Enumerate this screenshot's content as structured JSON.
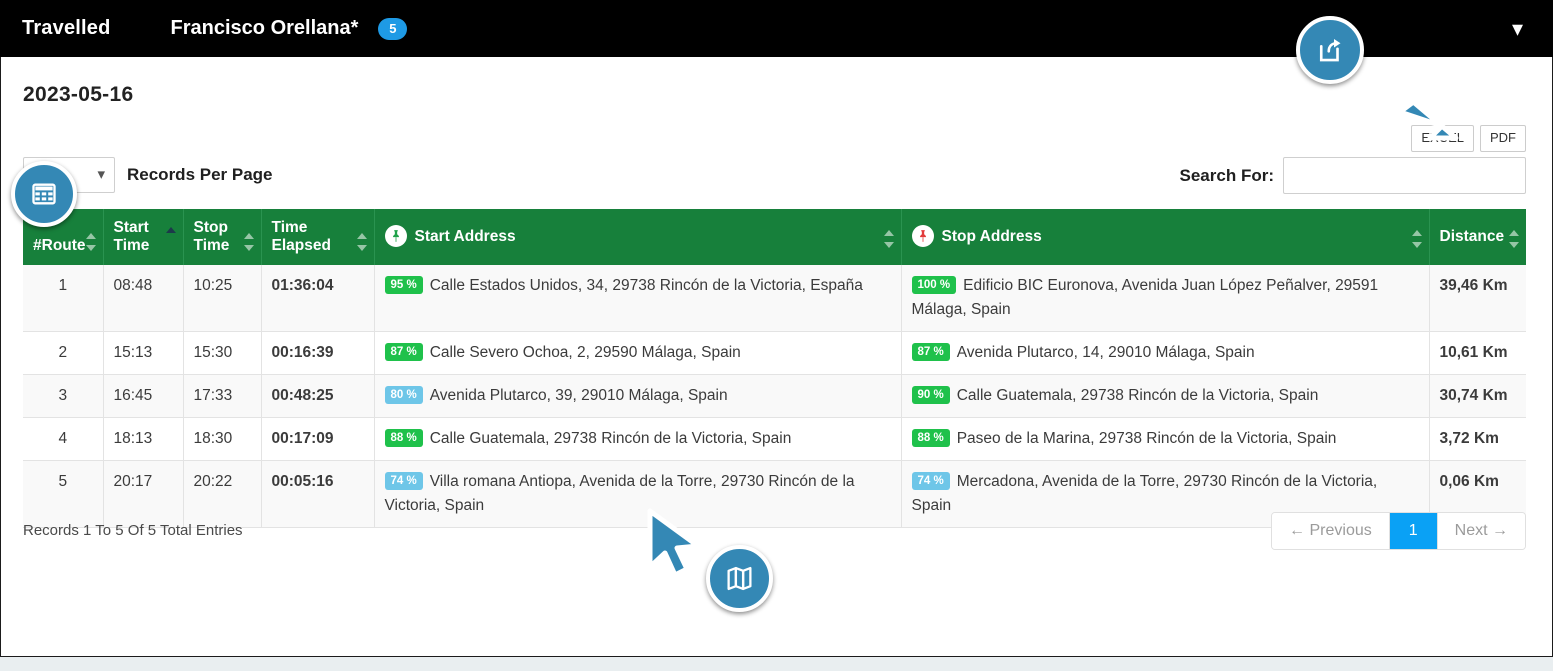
{
  "topbar": {
    "title": "Travelled",
    "user": "Francisco Orellana*",
    "badge_count": "5",
    "chevron_icon": "chevron-down-icon"
  },
  "header": {
    "date": "2023-05-16"
  },
  "export": {
    "excel_label": "EXCEL",
    "pdf_label": "PDF"
  },
  "controls": {
    "records_per_page_label": "Records Per Page",
    "records_per_page_value": "",
    "search_label": "Search For:",
    "search_value": "",
    "search_placeholder": ""
  },
  "table": {
    "columns": [
      {
        "label": "#Route",
        "sort": "none"
      },
      {
        "label": "Start Time",
        "sort": "asc"
      },
      {
        "label": "Stop Time",
        "sort": "none"
      },
      {
        "label": "Time Elapsed",
        "sort": "none"
      },
      {
        "label": "Start Address",
        "sort": "none",
        "icon": "green-pin-icon"
      },
      {
        "label": "Stop Address",
        "sort": "none",
        "icon": "red-pin-icon"
      },
      {
        "label": "Distance",
        "sort": "none"
      }
    ],
    "rows": [
      {
        "route": "1",
        "start_time": "08:48",
        "stop_time": "10:25",
        "elapsed": "01:36:04",
        "start_pct": "95 %",
        "start_pct_color": "green",
        "start_address": "Calle Estados Unidos, 34, 29738 Rincón de la Victoria, España",
        "stop_pct": "100 %",
        "stop_pct_color": "green",
        "stop_address": "Edificio BIC Euronova, Avenida Juan López Peñalver, 29591 Málaga, Spain",
        "distance": "39,46 Km"
      },
      {
        "route": "2",
        "start_time": "15:13",
        "stop_time": "15:30",
        "elapsed": "00:16:39",
        "start_pct": "87 %",
        "start_pct_color": "green",
        "start_address": "Calle Severo Ochoa, 2, 29590 Málaga, Spain",
        "stop_pct": "87 %",
        "stop_pct_color": "green",
        "stop_address": "Avenida Plutarco, 14, 29010 Málaga, Spain",
        "distance": "10,61 Km"
      },
      {
        "route": "3",
        "start_time": "16:45",
        "stop_time": "17:33",
        "elapsed": "00:48:25",
        "start_pct": "80 %",
        "start_pct_color": "blue",
        "start_address": "Avenida Plutarco, 39, 29010 Málaga, Spain",
        "stop_pct": "90 %",
        "stop_pct_color": "green",
        "stop_address": "Calle Guatemala, 29738 Rincón de la Victoria, Spain",
        "distance": "30,74 Km"
      },
      {
        "route": "4",
        "start_time": "18:13",
        "stop_time": "18:30",
        "elapsed": "00:17:09",
        "start_pct": "88 %",
        "start_pct_color": "green",
        "start_address": "Calle Guatemala, 29738 Rincón de la Victoria, Spain",
        "stop_pct": "88 %",
        "stop_pct_color": "green",
        "stop_address": "Paseo de la Marina, 29738 Rincón de la Victoria, Spain",
        "distance": "3,72 Km"
      },
      {
        "route": "5",
        "start_time": "20:17",
        "stop_time": "20:22",
        "elapsed": "00:05:16",
        "start_pct": "74 %",
        "start_pct_color": "blue",
        "start_address": "Villa romana Antiopa, Avenida de la Torre, 29730 Rincón de la Victoria, Spain",
        "stop_pct": "74 %",
        "stop_pct_color": "blue",
        "stop_address": "Mercadona, Avenida de la Torre, 29730 Rincón de la Victoria, Spain",
        "distance": "0,06 Km"
      }
    ]
  },
  "footer": {
    "info": "Records 1 To 5 Of 5 Total Entries",
    "previous_label": "← Previous",
    "page_1_label": "1",
    "next_label": "Next →"
  },
  "annotations": {
    "share_icon": "share-export-icon",
    "table_icon": "table-grid-icon",
    "map_icon": "map-icon"
  },
  "colors": {
    "header_green": "#17803b",
    "accent_blue": "#3488b5",
    "badge_blue": "#1e9ae5",
    "active_page_blue": "#0aa1f5",
    "pct_green": "#1fc14b",
    "pct_blue": "#6ec6e8"
  }
}
